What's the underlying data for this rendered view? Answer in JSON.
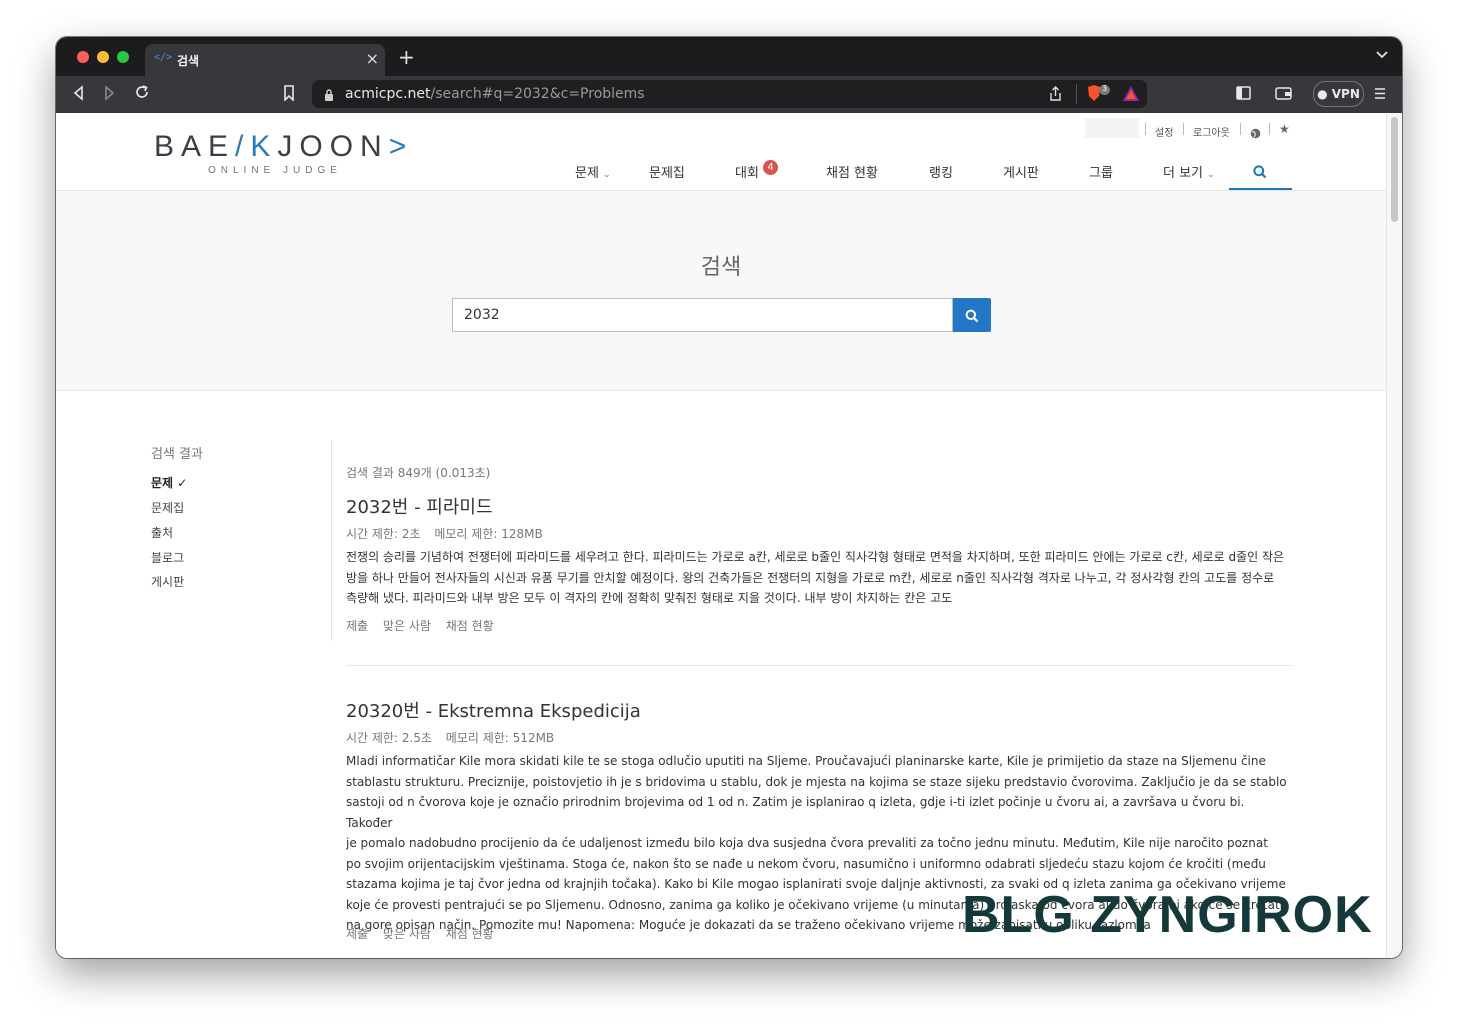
{
  "browser": {
    "tab_title": "검색",
    "tab_favicon": "</>",
    "tab_close": "×",
    "new_tab": "+",
    "url_domain": "acmicpc.net",
    "url_rest": "/search#q=2032&c=Problems",
    "vpn_label": "VPN",
    "brave_badge": "3"
  },
  "header": {
    "logo_main_left": "BAE",
    "logo_main_k": "/K",
    "logo_main_right": "JOON",
    "logo_main_arrow": ">",
    "logo_sub": "ONLINE JUDGE",
    "top_links": [
      "설정",
      "로그아웃"
    ],
    "nav": [
      {
        "label": "문제",
        "dropdown": true
      },
      {
        "label": "문제집"
      },
      {
        "label": "대회",
        "badge": "4"
      },
      {
        "label": "채점 현황"
      },
      {
        "label": "랭킹"
      },
      {
        "label": "게시판"
      },
      {
        "label": "그룹"
      },
      {
        "label": "더 보기",
        "dropdown": true
      }
    ],
    "accent_color": "#1f77b4"
  },
  "search": {
    "title": "검색",
    "query": "2032"
  },
  "sidebar": {
    "title": "검색 결과",
    "items": [
      "문제",
      "문제집",
      "출처",
      "블로그",
      "게시판"
    ],
    "selected_mark": "✓"
  },
  "results": {
    "count_text": "검색 결과 849개 (0.013초)",
    "items": [
      {
        "title": "2032번 - 피라미드",
        "time_limit": "시간 제한: 2초",
        "memory_limit": "메모리 제한: 128MB",
        "desc_lines": [
          "전쟁의 승리를 기념하여 전쟁터에 피라미드를 세우려고 한다. 피라미드는 가로로 a칸, 세로로 b줄인 직사각형 형태로 면적을 차지하며, 또한 피라미드 안에는 가로로 c칸, 세로로 d줄인 작은",
          "방을 하나 만들어 전사자들의 시신과 유품 무기를 안치할 예정이다. 왕의 건축가들은 전쟁터의 지형을 가로로 m칸, 세로로 n줄인 직사각형 격자로 나누고, 각 정사각형 칸의 고도를 정수로",
          "측량해 냈다. 피라미드와 내부 방은 모두 이 격자의 칸에 정확히 맞춰진 형태로 지을 것이다. 내부 방이 차지하는 칸은 고도"
        ],
        "links": [
          "제출",
          "맞은 사람",
          "채점 현황"
        ]
      },
      {
        "title": "20320번 - Ekstremna Ekspedicija",
        "time_limit": "시간 제한: 2.5초",
        "memory_limit": "메모리 제한: 512MB",
        "desc_lines": [
          "Mladi informatičar Kile mora skidati kile te se stoga odlučio uputiti na Sljeme. Proučavajući planinarske karte, Kile je primijetio da staze na Sljemenu čine",
          "stablastu strukturu. Preciznije, poistovjetio ih je s bridovima u stablu, dok je mjesta na kojima se staze sijeku predstavio čvorovima. Zaključio je da se stablo",
          "sastoji od n čvorova koje je označio prirodnim brojevima od 1 od n. Zatim je isplanirao q izleta, gdje i-ti izlet počinje u čvoru ai, a završava u čvoru bi. Također",
          "je pomalo nadobudno procijenio da će udaljenost između bilo koja dva susjedna čvora prevaliti za točno jednu minutu. Međutim, Kile nije naročito poznat",
          "po svojim orijentacijskim vještinama. Stoga će, nakon što se nađe u nekom čvoru, nasumično i uniformno odabrati sljedeću stazu kojom će kročiti (među",
          "stazama kojima je taj čvor jedna od krajnjih točaka). Kako bi Kile mogao isplanirati svoje daljnje aktivnosti, za svaki od q izleta zanima ga očekivano vrijeme",
          "koje će provesti pentrajući se po Sljemenu. Odnosno, zanima ga koliko je očekivano vrijeme (u minutama) prolaska od čvora ai do čvora bi ako će se kretati",
          "na gore opisan način. Pomozite mu! Napomena: Moguće je dokazati da se traženo očekivano vrijeme može zapisati u obliku razlomka"
        ],
        "links": [
          "제출",
          "맞은 사람",
          "채점 현황"
        ]
      }
    ]
  },
  "watermark": "BLG ZYNGIROK"
}
